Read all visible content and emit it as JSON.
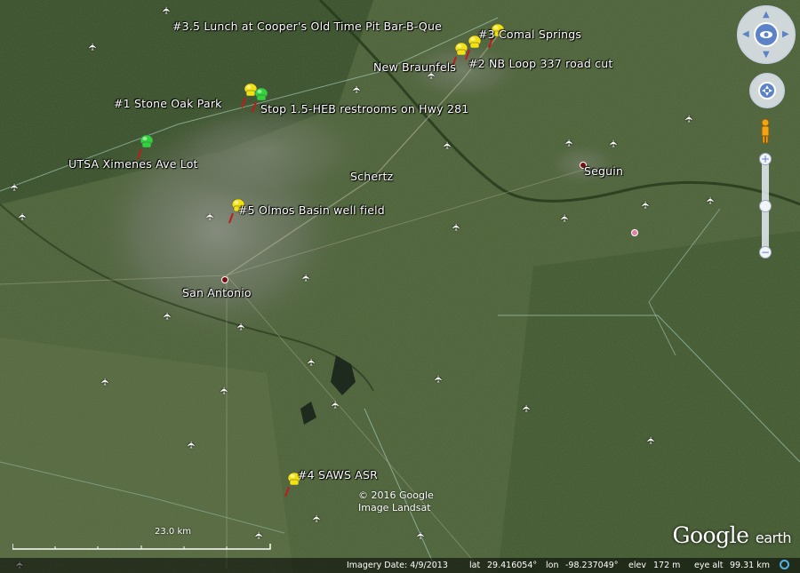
{
  "map": {
    "places": [
      {
        "id": "stop35",
        "text": "#3.5 Lunch at Cooper's Old Time Pit Bar-B-Que"
      },
      {
        "id": "stop3",
        "text": "#3 Comal Springs"
      },
      {
        "id": "newbraunfels",
        "text": "New Braunfels"
      },
      {
        "id": "stop2",
        "text": "#2 NB Loop 337 road cut"
      },
      {
        "id": "stop1",
        "text": "#1 Stone Oak Park"
      },
      {
        "id": "stop15",
        "text": "Stop 1.5-HEB restrooms on Hwy 281"
      },
      {
        "id": "utsa",
        "text": "UTSA Ximenes Ave Lot"
      },
      {
        "id": "schertz",
        "text": "Schertz"
      },
      {
        "id": "seguin",
        "text": "Seguin"
      },
      {
        "id": "stop5",
        "text": "#5 Olmos Basin well field"
      },
      {
        "id": "sanantonio",
        "text": "San Antonio"
      },
      {
        "id": "stop4",
        "text": "#4 SAWS ASR"
      }
    ],
    "pin_colors": {
      "yellow": "#f2e20f",
      "green": "#2fd43a"
    },
    "copyright_line1": "© 2016 Google",
    "copyright_line2": "Image Landsat",
    "scale_label": "23.0 km",
    "logo_main": "Google",
    "logo_sub": "earth"
  },
  "status": {
    "imagery_date": "Imagery Date: 4/9/2013",
    "lat_label": "lat",
    "lat_value": "29.416054°",
    "lon_label": "lon",
    "lon_value": "-98.237049°",
    "elev_label": "elev",
    "elev_value": "172 m",
    "eye_label": "eye alt",
    "eye_value": "99.31 km"
  },
  "controls": {
    "icons": [
      "look-navigation-icon",
      "move-navigation-icon",
      "street-view-pegman-icon",
      "zoom-in-icon",
      "zoom-out-icon"
    ],
    "zoom_in": "+",
    "zoom_out": "−"
  }
}
